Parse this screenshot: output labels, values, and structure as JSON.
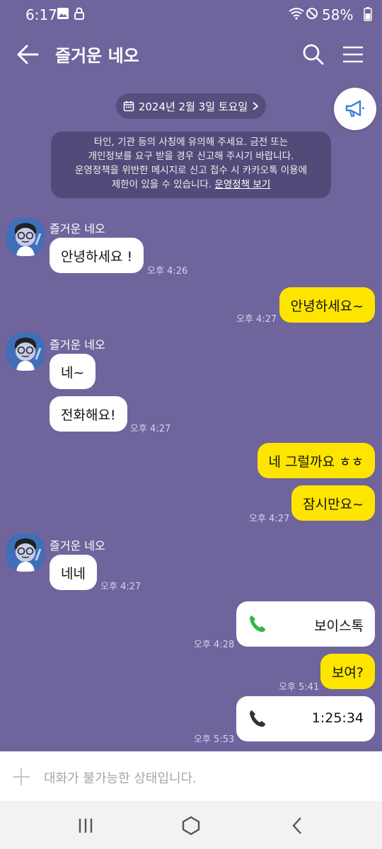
{
  "status": {
    "time": "6:17",
    "battery": "58%"
  },
  "header": {
    "title": "즐거운 네오"
  },
  "date_pill": "2024년 2월 3일 토요일",
  "notice": {
    "line1": "타인, 기관 등의 사칭에 유의해 주세요. 금전 또는",
    "line2": "개인정보를 요구 받을 경우 신고해 주시기 바랍니다.",
    "line3": "운영정책을 위반한 메시지로 신고 접수 시 카카오톡 이용에",
    "line4_prefix": "제한이 있을 수 있습니다. ",
    "policy_link": "운영정책 보기"
  },
  "messages": [
    {
      "sender": "즐거운 네오",
      "text": "안녕하세요 !",
      "time": "오후 4:26"
    },
    {
      "text": "안녕하세요~",
      "time": "오후 4:27"
    },
    {
      "sender": "즐거운 네오",
      "text": "네~"
    },
    {
      "text": "전화해요!",
      "time": "오후 4:27"
    },
    {
      "text": "네 그럴까요 ㅎㅎ"
    },
    {
      "text": "잠시만요~",
      "time": "오후 4:27"
    },
    {
      "sender": "즐거운 네오",
      "text": "네네",
      "time": "오후 4:27"
    },
    {
      "text": "보이스톡",
      "time": "오후 4:28"
    },
    {
      "text": "보여?",
      "time": "오후 5:41"
    },
    {
      "text": "1:25:34",
      "time": "오후 5:53"
    }
  ],
  "input": {
    "placeholder": "대화가 불가능한 상태입니다."
  },
  "colors": {
    "background": "#6f649c",
    "my_bubble": "#fee500",
    "their_bubble": "#ffffff",
    "call_green": "#2db84c"
  }
}
